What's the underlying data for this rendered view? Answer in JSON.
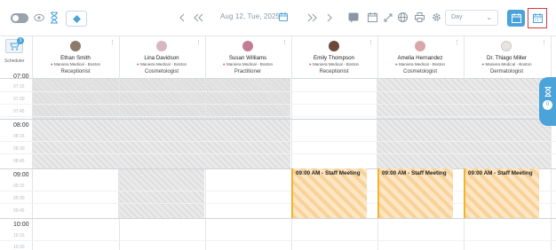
{
  "toolbar": {
    "date": "Aug 12, Tue, 2025",
    "view": "Day",
    "prev_icon": "chevron-left-icon",
    "prev_double_icon": "double-chevron-left-icon",
    "next_double_icon": "double-chevron-right-icon",
    "next_icon": "chevron-right-icon"
  },
  "scheduler": {
    "label": "Scheduler",
    "badge": "3"
  },
  "staff": [
    {
      "name": "Ethan Smith",
      "location": "Maniera Medical - Boston",
      "role": "Receptionist",
      "avatar_color": "#8c7b6b"
    },
    {
      "name": "Lina Davidson",
      "location": "Maniera Medical - Boston",
      "role": "Cosmetologist",
      "avatar_color": "#d8b6c4"
    },
    {
      "name": "Susan Williams",
      "location": "Maniera Medical - Boston",
      "role": "Practitioner",
      "avatar_color": "#c47a93"
    },
    {
      "name": "Emily Thompson",
      "location": "Maniera Medical - Boston",
      "role": "Receptionist",
      "avatar_color": "#6b4a3a"
    },
    {
      "name": "Amelia Hernandez",
      "location": "Maniera Medical - Boston",
      "role": "Cosmetologist",
      "avatar_color": "#d9a7a7"
    },
    {
      "name": "Dr. Thiago Miller",
      "location": "Maniera Medical - Boston",
      "role": "Dermatologist",
      "avatar_color": "#e8e3df"
    }
  ],
  "time_labels": [
    "07:00",
    "07:15",
    "07:30",
    "07:45",
    "08:00",
    "08:15",
    "08:30",
    "08:45",
    "09:00",
    "09:15",
    "09:30",
    "09:45",
    "10:00",
    "10:15",
    "10:30"
  ],
  "events": [
    {
      "title": "09:00 AM - Staff Meeting"
    },
    {
      "title": "09:00 AM - Staff Meeting"
    },
    {
      "title": "09:00 AM - Staff Meeting"
    }
  ],
  "side_panel": {
    "count": "0"
  },
  "colors": {
    "accent": "#4aa3d9",
    "event_border": "#f2b32b",
    "highlight_outline": "#d9363e"
  }
}
